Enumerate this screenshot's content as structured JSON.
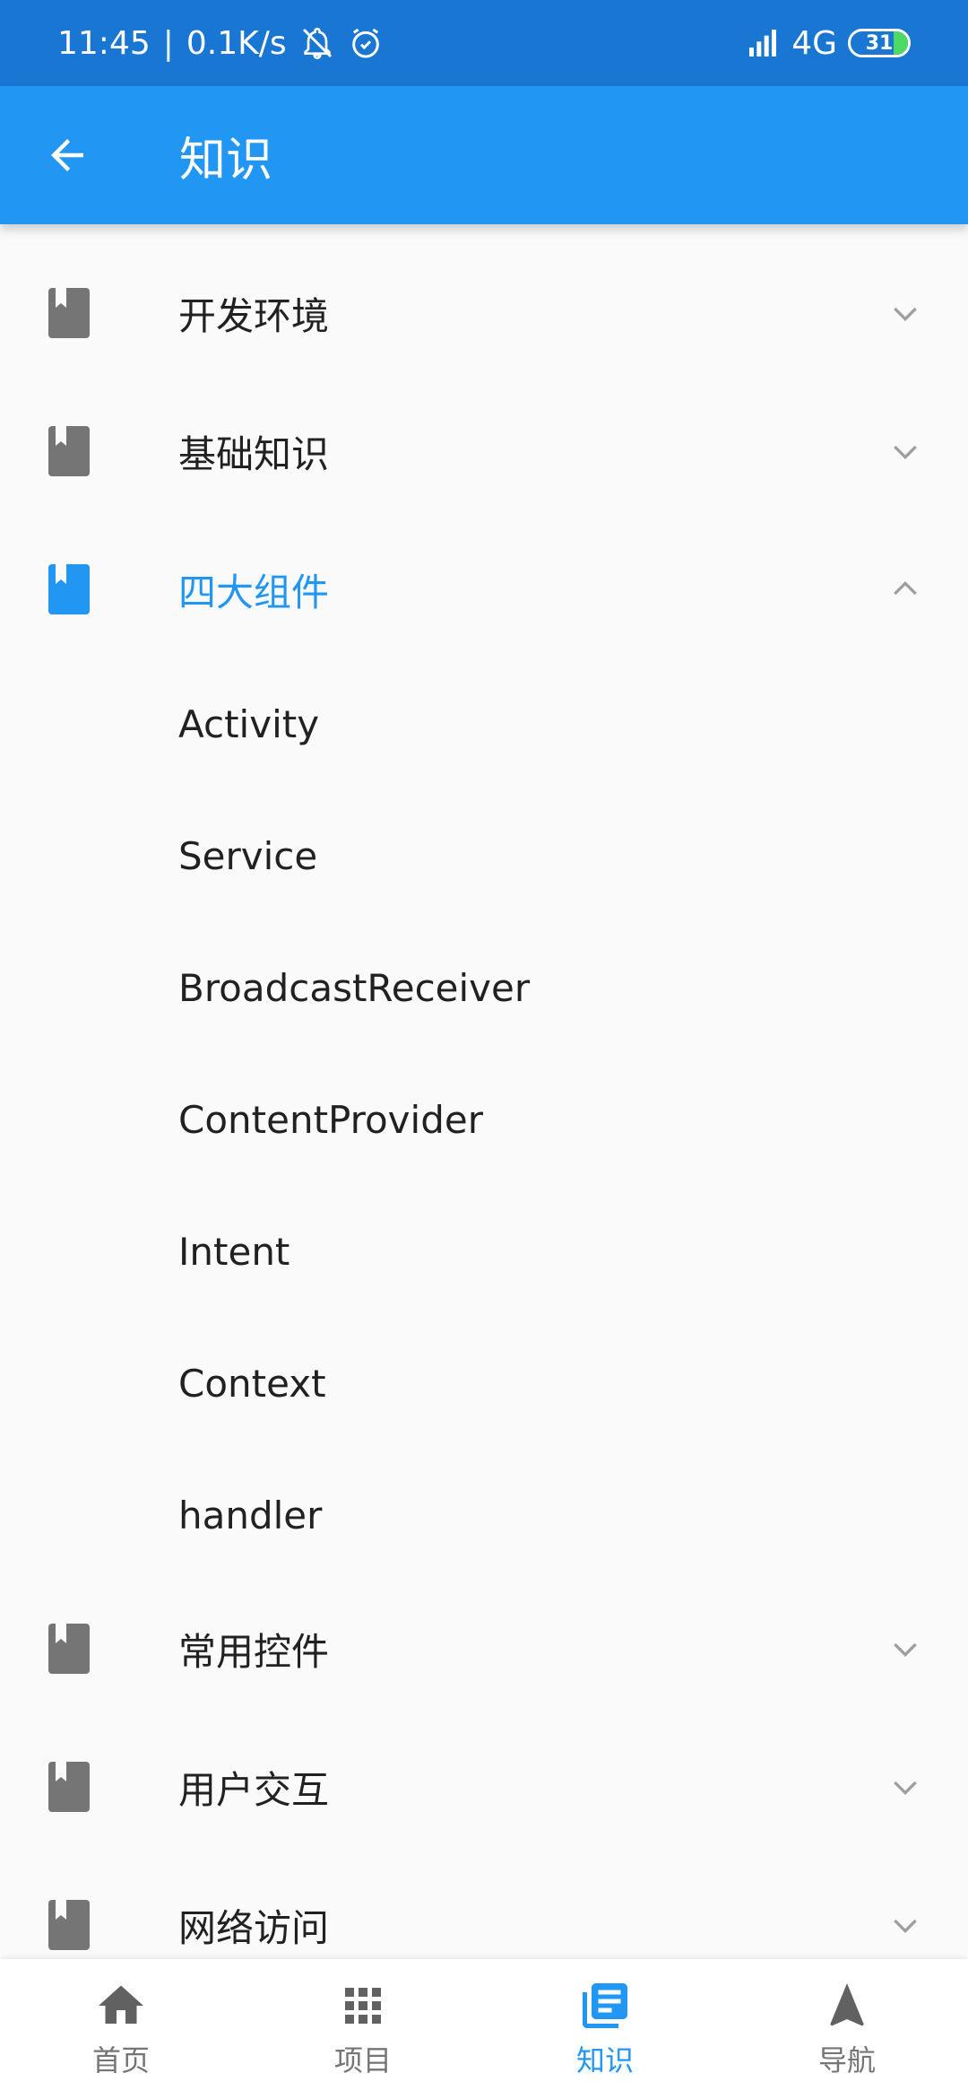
{
  "status_bar": {
    "time": "11:45",
    "separator": "|",
    "net_speed": "0.1K/s",
    "network_type": "4G",
    "battery_level": "31",
    "icons": [
      "bell-off-icon",
      "alarm-icon",
      "signal-icon",
      "battery-icon"
    ]
  },
  "app_bar": {
    "title": "知识",
    "back_icon": "arrow-back-icon"
  },
  "list": {
    "groups_before": [
      {
        "label": "开发环境",
        "expanded": false
      },
      {
        "label": "基础知识",
        "expanded": false
      }
    ],
    "expanded_group": {
      "label": "四大组件",
      "expanded": true,
      "children": [
        "Activity",
        "Service",
        "BroadcastReceiver",
        "ContentProvider",
        "Intent",
        "Context",
        "handler"
      ]
    },
    "groups_after": [
      {
        "label": "常用控件",
        "expanded": false
      },
      {
        "label": "用户交互",
        "expanded": false
      },
      {
        "label": "网络访问",
        "expanded": false
      }
    ]
  },
  "bottom_nav": {
    "items": [
      {
        "label": "首页",
        "icon": "home-icon"
      },
      {
        "label": "项目",
        "icon": "grid-icon"
      },
      {
        "label": "知识",
        "icon": "article-icon"
      },
      {
        "label": "导航",
        "icon": "navigation-icon"
      }
    ],
    "active_index": 2
  },
  "colors": {
    "status_bar": "#1976d2",
    "app_bar": "#2196f3",
    "accent": "#2196f3",
    "icon_gray": "#757575",
    "background": "#fafafa"
  }
}
